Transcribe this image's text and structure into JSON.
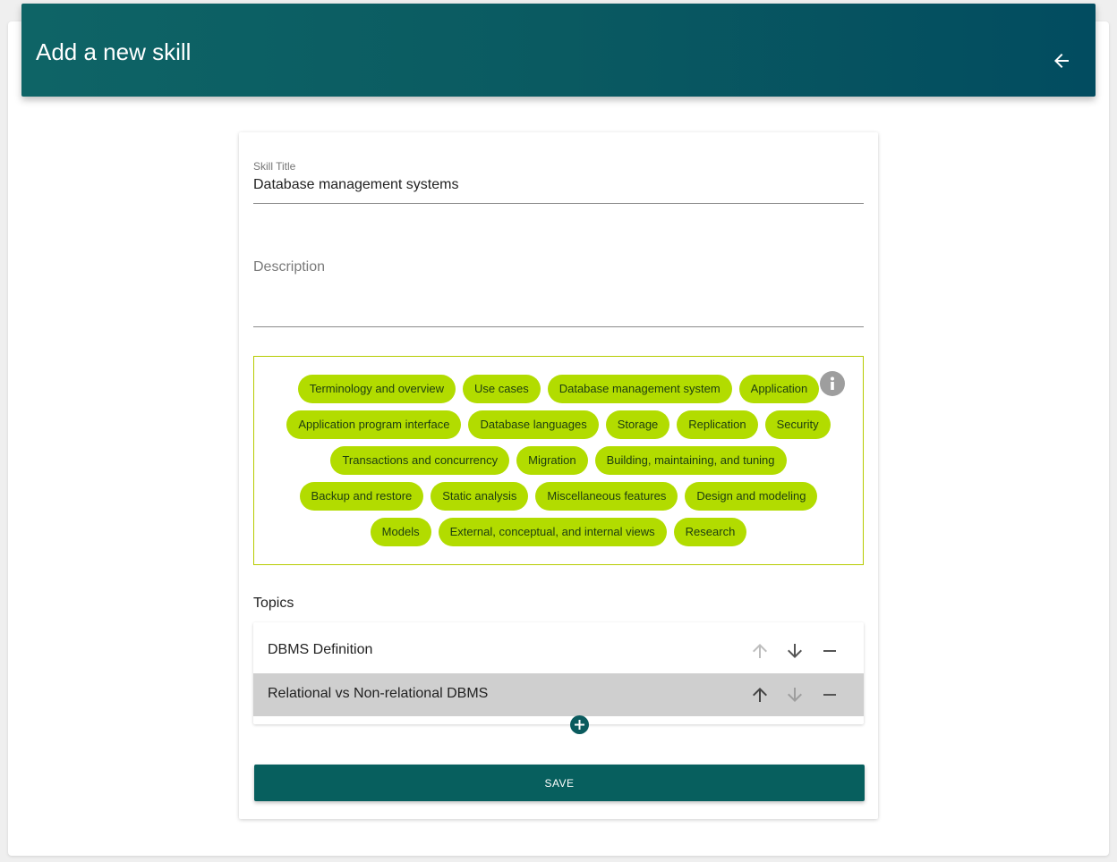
{
  "header": {
    "title": "Add a new skill",
    "back_icon": "arrow-left-icon"
  },
  "form": {
    "title_label": "Skill Title",
    "title_value": "Database management systems",
    "description_placeholder": "Description",
    "info_icon": "info-icon",
    "tags": [
      "Terminology and overview",
      "Use cases",
      "Database management system",
      "Application",
      "Application program interface",
      "Database languages",
      "Storage",
      "Replication",
      "Security",
      "Transactions and concurrency",
      "Migration",
      "Building, maintaining, and tuning",
      "Backup and restore",
      "Static analysis",
      "Miscellaneous features",
      "Design and modeling",
      "Models",
      "External, conceptual, and internal views",
      "Research"
    ],
    "tag_color": "#b2dc00"
  },
  "topics": {
    "label": "Topics",
    "items": [
      {
        "name": "DBMS Definition",
        "selected": false,
        "up_enabled": false,
        "down_enabled": true
      },
      {
        "name": "Relational vs Non-relational DBMS",
        "selected": true,
        "up_enabled": true,
        "down_enabled": false
      }
    ],
    "add_icon": "plus-circle-icon"
  },
  "actions": {
    "save_label": "SAVE"
  },
  "colors": {
    "accent": "#075f5e",
    "header_start": "#0e6466",
    "header_end": "#024c60",
    "selected_row": "#cfcfcf"
  }
}
